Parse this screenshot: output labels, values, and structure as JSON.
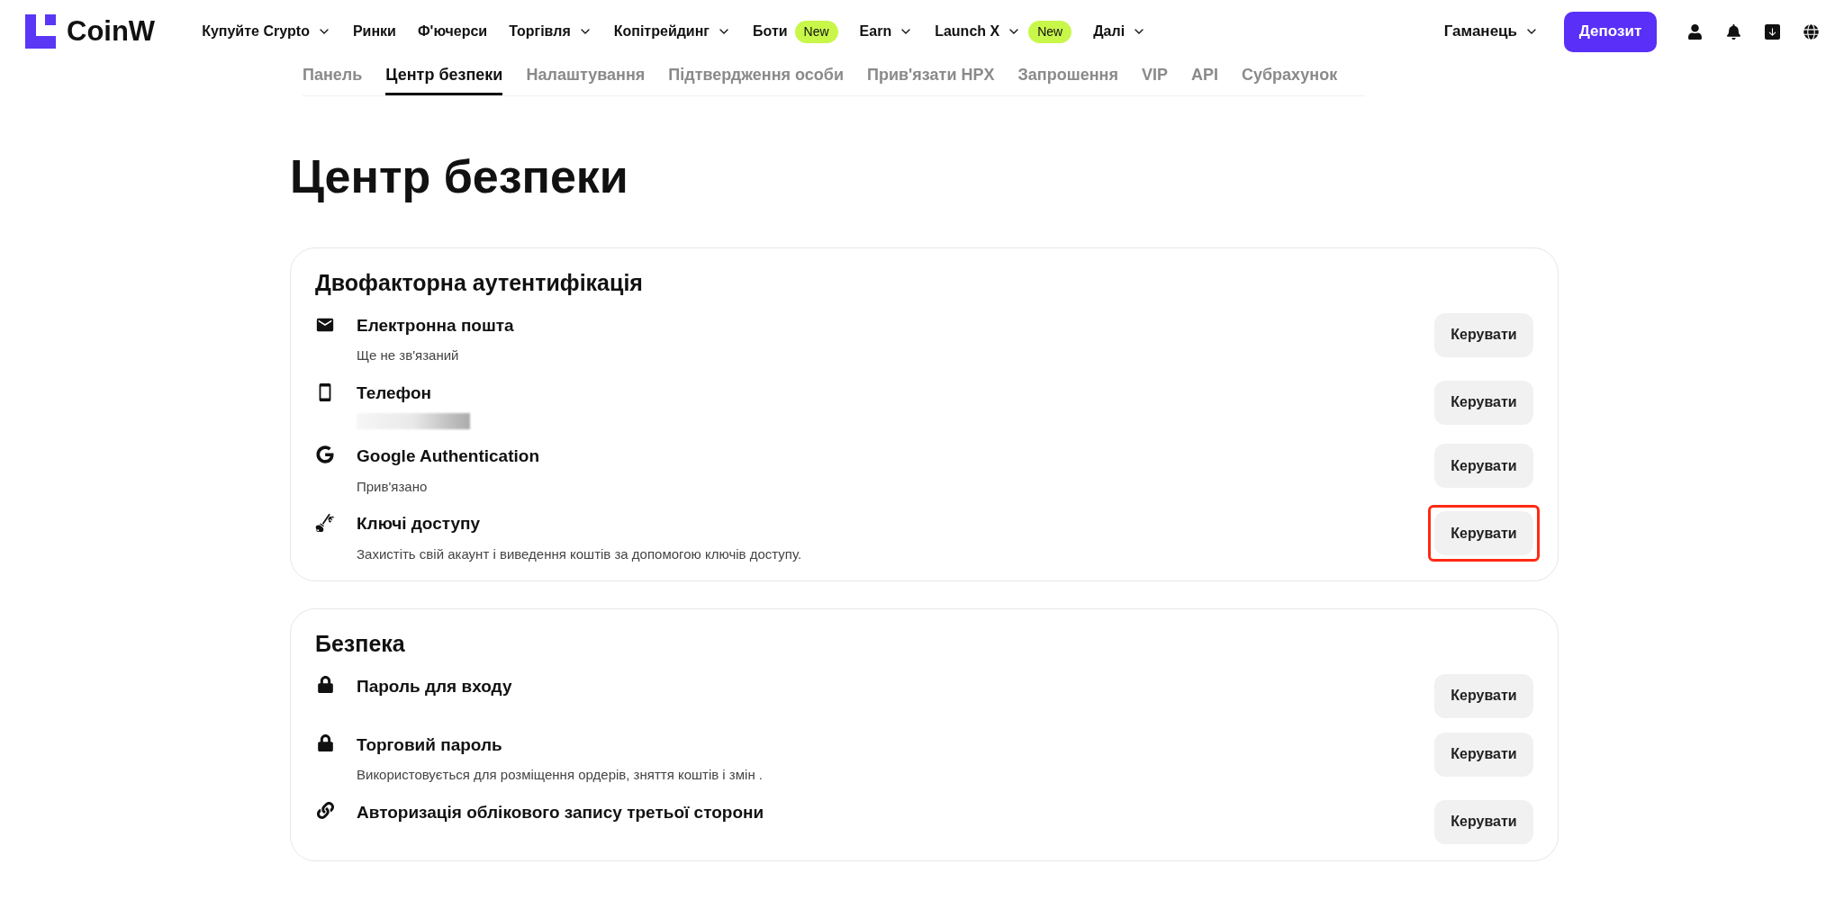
{
  "header": {
    "logo": "CoinW",
    "nav": [
      {
        "label": "Купуйте Crypto",
        "dropdown": true
      },
      {
        "label": "Ринки",
        "dropdown": false
      },
      {
        "label": "Ф'ючерси",
        "dropdown": false
      },
      {
        "label": "Торгівля",
        "dropdown": true
      },
      {
        "label": "Копітрейдинг",
        "dropdown": true
      },
      {
        "label": "Боти",
        "dropdown": false,
        "badge": "New"
      },
      {
        "label": "Earn",
        "dropdown": true
      },
      {
        "label": "Launch X",
        "dropdown": true,
        "badge": "New"
      },
      {
        "label": "Далі",
        "dropdown": true
      }
    ],
    "wallet": {
      "label": "Гаманець",
      "dropdown": true
    },
    "deposit_button": "Депозит"
  },
  "tabs": [
    {
      "label": "Панель",
      "selected": false
    },
    {
      "label": "Центр безпеки",
      "selected": true
    },
    {
      "label": "Налаштування",
      "selected": false
    },
    {
      "label": "Підтвердження особи",
      "selected": false
    },
    {
      "label": "Прив'язати HPX",
      "selected": false
    },
    {
      "label": "Запрошення",
      "selected": false
    },
    {
      "label": "VIP",
      "selected": false
    },
    {
      "label": "API",
      "selected": false
    },
    {
      "label": "Субрахунок",
      "selected": false
    }
  ],
  "page_title": "Центр безпеки",
  "sections": [
    {
      "title": "Двофакторна аутентифікація",
      "items": [
        {
          "kind": "email",
          "title": "Електронна пошта",
          "detail": "Ще не зв'язаний",
          "button": "Керувати",
          "highlighted": false
        },
        {
          "kind": "phone",
          "title": "Телефон",
          "detail_redacted": true,
          "button": "Керувати",
          "highlighted": false
        },
        {
          "kind": "google",
          "title": "Google Authentication",
          "detail": "Прив'язано",
          "button": "Керувати",
          "highlighted": false
        },
        {
          "kind": "key",
          "title": "Ключі доступу",
          "detail": "Захистіть свій акаунт і виведення коштів за допомогою ключів доступу.",
          "button": "Керувати",
          "highlighted": true
        }
      ]
    },
    {
      "title": "Безпека",
      "items": [
        {
          "kind": "lock",
          "title": "Пароль для входу",
          "button": "Керувати",
          "highlighted": false
        },
        {
          "kind": "lock",
          "title": "Торговий пароль",
          "detail": "Використовується для розміщення ордерів, зняття коштів і змін .",
          "button": "Керувати",
          "highlighted": false
        },
        {
          "kind": "link",
          "title": "Авторизація облікового запису третьої сторони",
          "button": "Керувати",
          "highlighted": false
        }
      ]
    }
  ]
}
